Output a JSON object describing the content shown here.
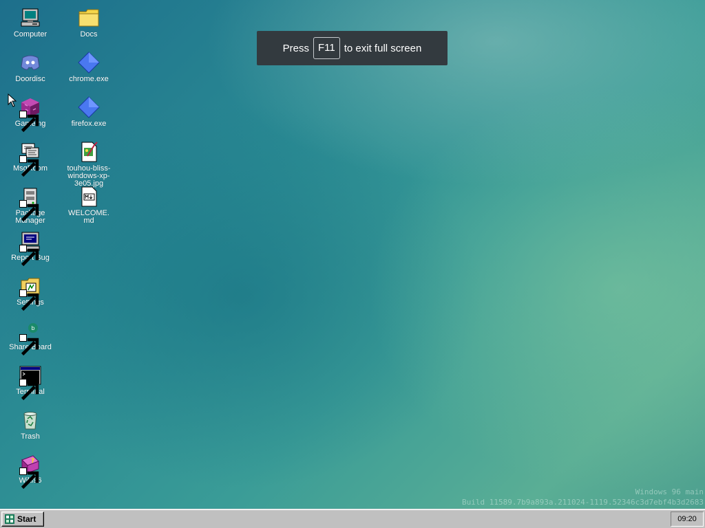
{
  "desktop": {
    "icons_col1": [
      {
        "label": "Computer",
        "icon": "computer-icon",
        "shortcut": false
      },
      {
        "label": "Doordisc",
        "icon": "discord-icon",
        "shortcut": false
      },
      {
        "label": "Gameing",
        "icon": "game-cube-icon",
        "shortcut": true
      },
      {
        "label": "MsgRoom",
        "icon": "msgroom-icon",
        "shortcut": true
      },
      {
        "label": "Package Manager",
        "icon": "package-manager-icon",
        "shortcut": true
      },
      {
        "label": "Report Bug",
        "icon": "report-bug-icon",
        "shortcut": true
      },
      {
        "label": "Settings",
        "icon": "settings-folder-icon",
        "shortcut": true
      },
      {
        "label": "Share Board",
        "icon": "share-board-icon",
        "shortcut": true
      },
      {
        "label": "Terminal",
        "icon": "terminal-icon",
        "shortcut": true
      },
      {
        "label": "Trash",
        "icon": "recycle-bin-icon",
        "shortcut": false
      },
      {
        "label": "Wiki96",
        "icon": "help-book-icon",
        "shortcut": true
      }
    ],
    "icons_col2": [
      {
        "label": "Docs",
        "icon": "folder-icon",
        "shortcut": false
      },
      {
        "label": "chrome.exe",
        "icon": "blue-diamond-icon",
        "shortcut": false
      },
      {
        "label": "firefox.exe",
        "icon": "blue-diamond-icon",
        "shortcut": false
      },
      {
        "label": "touhou-bliss-windows-xp-3e05.jpg",
        "label_display": "touhou-bliss-windows-xp-3e05.jpg",
        "icon": "image-file-icon",
        "shortcut": false
      },
      {
        "label": "WELCOME.md",
        "icon": "markdown-file-icon",
        "shortcut": false
      }
    ]
  },
  "fullscreen_toast": {
    "prefix": "Press",
    "key": "F11",
    "suffix": "to exit full screen"
  },
  "watermark": {
    "line1": "Windows 96 main",
    "line2": "Build 11589.7b9a893a.211024-1119.52346c3d7ebf4b3d2683"
  },
  "taskbar": {
    "start_label": "Start",
    "clock": "09:20"
  },
  "colors": {
    "taskbar": "#c0c0c0",
    "toast_bg": "#333a3f",
    "desktop_accent": "#2a8a93"
  }
}
